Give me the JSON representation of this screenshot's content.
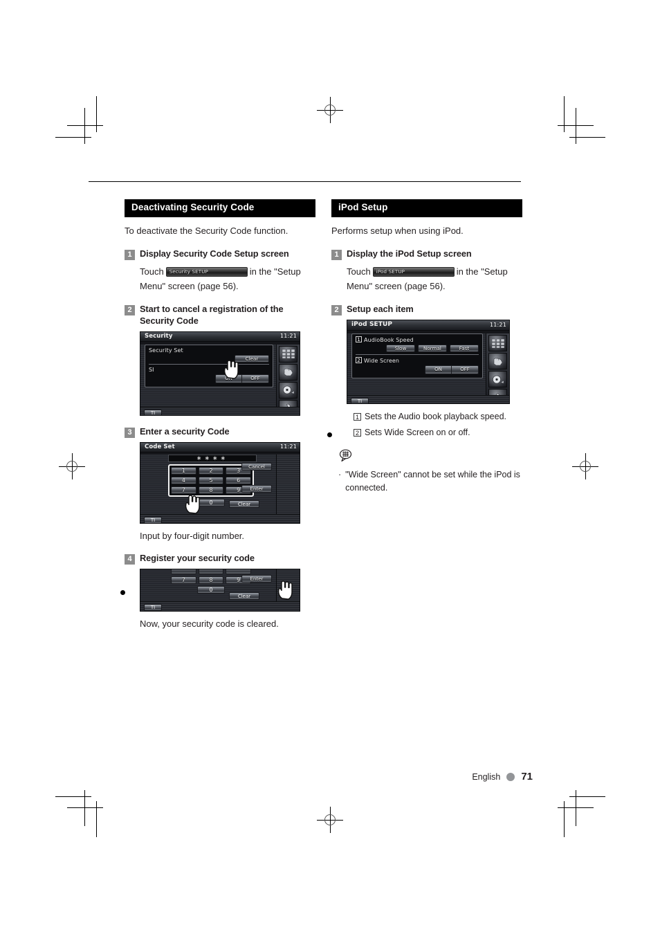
{
  "page": {
    "footer_language": "English",
    "footer_page": "71"
  },
  "left_column": {
    "section_title": "Deactivating Security Code",
    "intro": "To deactivate the Security Code function.",
    "steps": [
      {
        "num": "1",
        "title": "Display Security Code Setup screen",
        "touch_prefix": "Touch",
        "key_label": "Security SETUP",
        "touch_suffix": "in the \"Setup Menu\" screen (page 56)."
      },
      {
        "num": "2",
        "title": "Start to cancel a registration of the Security Code"
      },
      {
        "num": "3",
        "title": "Enter a security Code",
        "caption": "Input by four-digit number."
      },
      {
        "num": "4",
        "title": "Register your security code",
        "caption": "Now, your security code is cleared."
      }
    ],
    "security_screen": {
      "title": "Security",
      "clock": "11:21",
      "rows": [
        {
          "label": "Security Set",
          "button": "Clear"
        },
        {
          "label": "SI",
          "buttons": [
            "ON",
            "OFF"
          ]
        }
      ],
      "ti_button": "TI"
    },
    "code_set_screen": {
      "title": "Code Set",
      "clock": "11:21",
      "display": "∗∗∗∗",
      "keys": [
        [
          "1",
          "2",
          "3"
        ],
        [
          "4",
          "5",
          "6"
        ],
        [
          "7",
          "8",
          "9"
        ]
      ],
      "zero_key": "0",
      "cancel_button": "Cancel",
      "enter_button": "Enter",
      "clear_button": "Clear",
      "ti_button": "TI"
    },
    "register_screen": {
      "keys_row": [
        "7",
        "8",
        "9"
      ],
      "zero_key": "0",
      "enter_button": "Enter",
      "clear_button": "Clear",
      "ti_button": "TI"
    }
  },
  "right_column": {
    "section_title": "iPod Setup",
    "intro": "Performs setup when using iPod.",
    "steps": [
      {
        "num": "1",
        "title": "Display the iPod Setup screen",
        "touch_prefix": "Touch",
        "key_label": "iPod SETUP",
        "touch_suffix": "in the \"Setup Menu\" screen (page 56)."
      },
      {
        "num": "2",
        "title": "Setup each item"
      }
    ],
    "ipod_screen": {
      "title": "iPod SETUP",
      "clock": "11:21",
      "rows": [
        {
          "num": "1",
          "label": "AudioBook Speed",
          "buttons": [
            "Slow",
            "Normal",
            "Fast"
          ]
        },
        {
          "num": "2",
          "label": "Wide Screen",
          "buttons": [
            "ON",
            "OFF"
          ]
        }
      ],
      "ti_button": "TI"
    },
    "item_notes": [
      {
        "num": "1",
        "text": "Sets the Audio book playback speed."
      },
      {
        "num": "2",
        "text": "Sets Wide Screen on or off."
      }
    ],
    "note_bullet": "·",
    "note_text": "\"Wide Screen\" cannot be set while the iPod is connected."
  }
}
